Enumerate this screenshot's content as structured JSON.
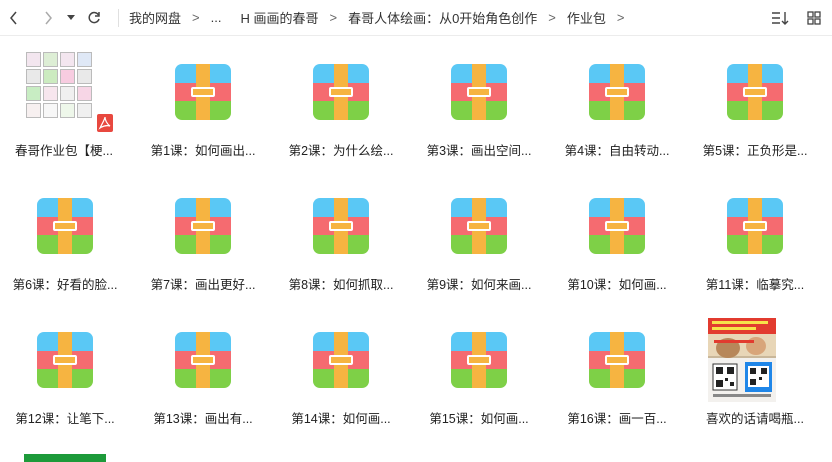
{
  "toolbar": {
    "back_icon": "chevron-left-icon",
    "forward_icon": "chevron-right-icon",
    "history_icon": "caret-down-icon",
    "refresh_icon": "refresh-icon",
    "breadcrumb": [
      "我的网盘",
      "...",
      "H 画画的春哥",
      "春哥人体绘画：从0开始角色创作",
      "作业包"
    ],
    "sort_icon": "sort-icon",
    "view_icon": "grid-view-icon"
  },
  "files": [
    {
      "name": "春哥作业包【梗...",
      "type": "pdf"
    },
    {
      "name": "第1课：如何画出...",
      "type": "zip"
    },
    {
      "name": "第2课：为什么绘...",
      "type": "zip"
    },
    {
      "name": "第3课：画出空间...",
      "type": "zip"
    },
    {
      "name": "第4课：自由转动...",
      "type": "zip"
    },
    {
      "name": "第5课：正负形是...",
      "type": "zip"
    },
    {
      "name": "第6课：好看的脸...",
      "type": "zip"
    },
    {
      "name": "第7课：画出更好...",
      "type": "zip"
    },
    {
      "name": "第8课：如何抓取...",
      "type": "zip"
    },
    {
      "name": "第9课：如何来画...",
      "type": "zip"
    },
    {
      "name": "第10课：如何画...",
      "type": "zip"
    },
    {
      "name": "第11课：临摹究...",
      "type": "zip"
    },
    {
      "name": "第12课：让笔下...",
      "type": "zip"
    },
    {
      "name": "第13课：画出有...",
      "type": "zip"
    },
    {
      "name": "第14课：如何画...",
      "type": "zip"
    },
    {
      "name": "第15课：如何画...",
      "type": "zip"
    },
    {
      "name": "第16课：画一百...",
      "type": "zip"
    },
    {
      "name": "喜欢的话请喝瓶...",
      "type": "image"
    }
  ],
  "colors": {
    "zip_blue": "#5ac8f5",
    "zip_red": "#f56b70",
    "zip_green": "#7ed047",
    "zip_strap": "#f6b441",
    "pdf_badge": "#e8483f"
  }
}
